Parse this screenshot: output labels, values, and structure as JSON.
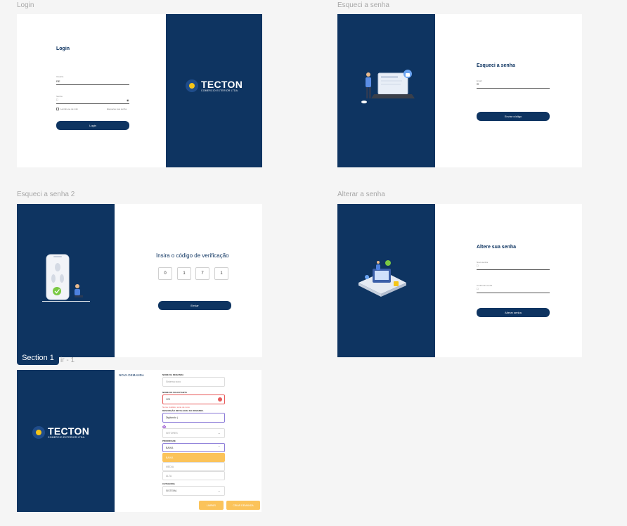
{
  "frames": {
    "login": {
      "label": "Login",
      "title": "Login",
      "user_label": "Usuário",
      "user_value": "RE",
      "password_label": "Senha",
      "remember_label": "Lembre-se de mim",
      "forgot_link": "Esqueceu sua senha",
      "button": "Login",
      "brand": "TECTON",
      "brand_sub": "COMERCIO EXTERIOR LTDA."
    },
    "forgot": {
      "label": "Esqueci a senha",
      "title": "Esqueci a senha",
      "email_label": "Email",
      "button": "Enviar código"
    },
    "forgot2": {
      "label": "Esqueci a senha 2",
      "title": "Insira o código de verificação",
      "digits": [
        "0",
        "1",
        "7",
        "1"
      ],
      "button": "Enviar"
    },
    "change": {
      "label": "Alterar a senha",
      "title": "Altere sua senha",
      "new_label": "Nova senha",
      "confirm_label": "Confirmar senha",
      "button": "Alterar senha"
    },
    "demand": {
      "label_suffix": "ir - 1",
      "section_badge": "Section 1",
      "sidebar_item": "NOVA DEMANDA",
      "brand": "TECTON",
      "brand_sub": "COMERCIO EXTERIOR LTDA.",
      "name_label": "NOME DA DEMANDA",
      "name_placeholder": "Sistema novo",
      "requester_label": "NOME DO SOLICITANTE",
      "requester_value": "123",
      "requester_error": "Nome inválido, tente de novo",
      "description_label": "DESCRIÇÃO DETALHADA DA DEMANDA",
      "description_value": "Digitando |",
      "sector_select": "SETORES",
      "priority_label": "PRIORIDADE",
      "priority_value": "BAIXA",
      "priority_options": [
        "BAIXA",
        "MÉDIA",
        "ALTA"
      ],
      "category_label": "CATEGORIA",
      "category_value": "SISTEMA",
      "clear_button": "LIMPAR",
      "create_button": "CRIAR DEMANDA"
    }
  },
  "colors": {
    "navy": "#0e3461",
    "accent_yellow": "#f5c518",
    "button_orange": "#fbc35a",
    "error_red": "#e85a5a",
    "focus_purple": "#8b7bd8"
  }
}
